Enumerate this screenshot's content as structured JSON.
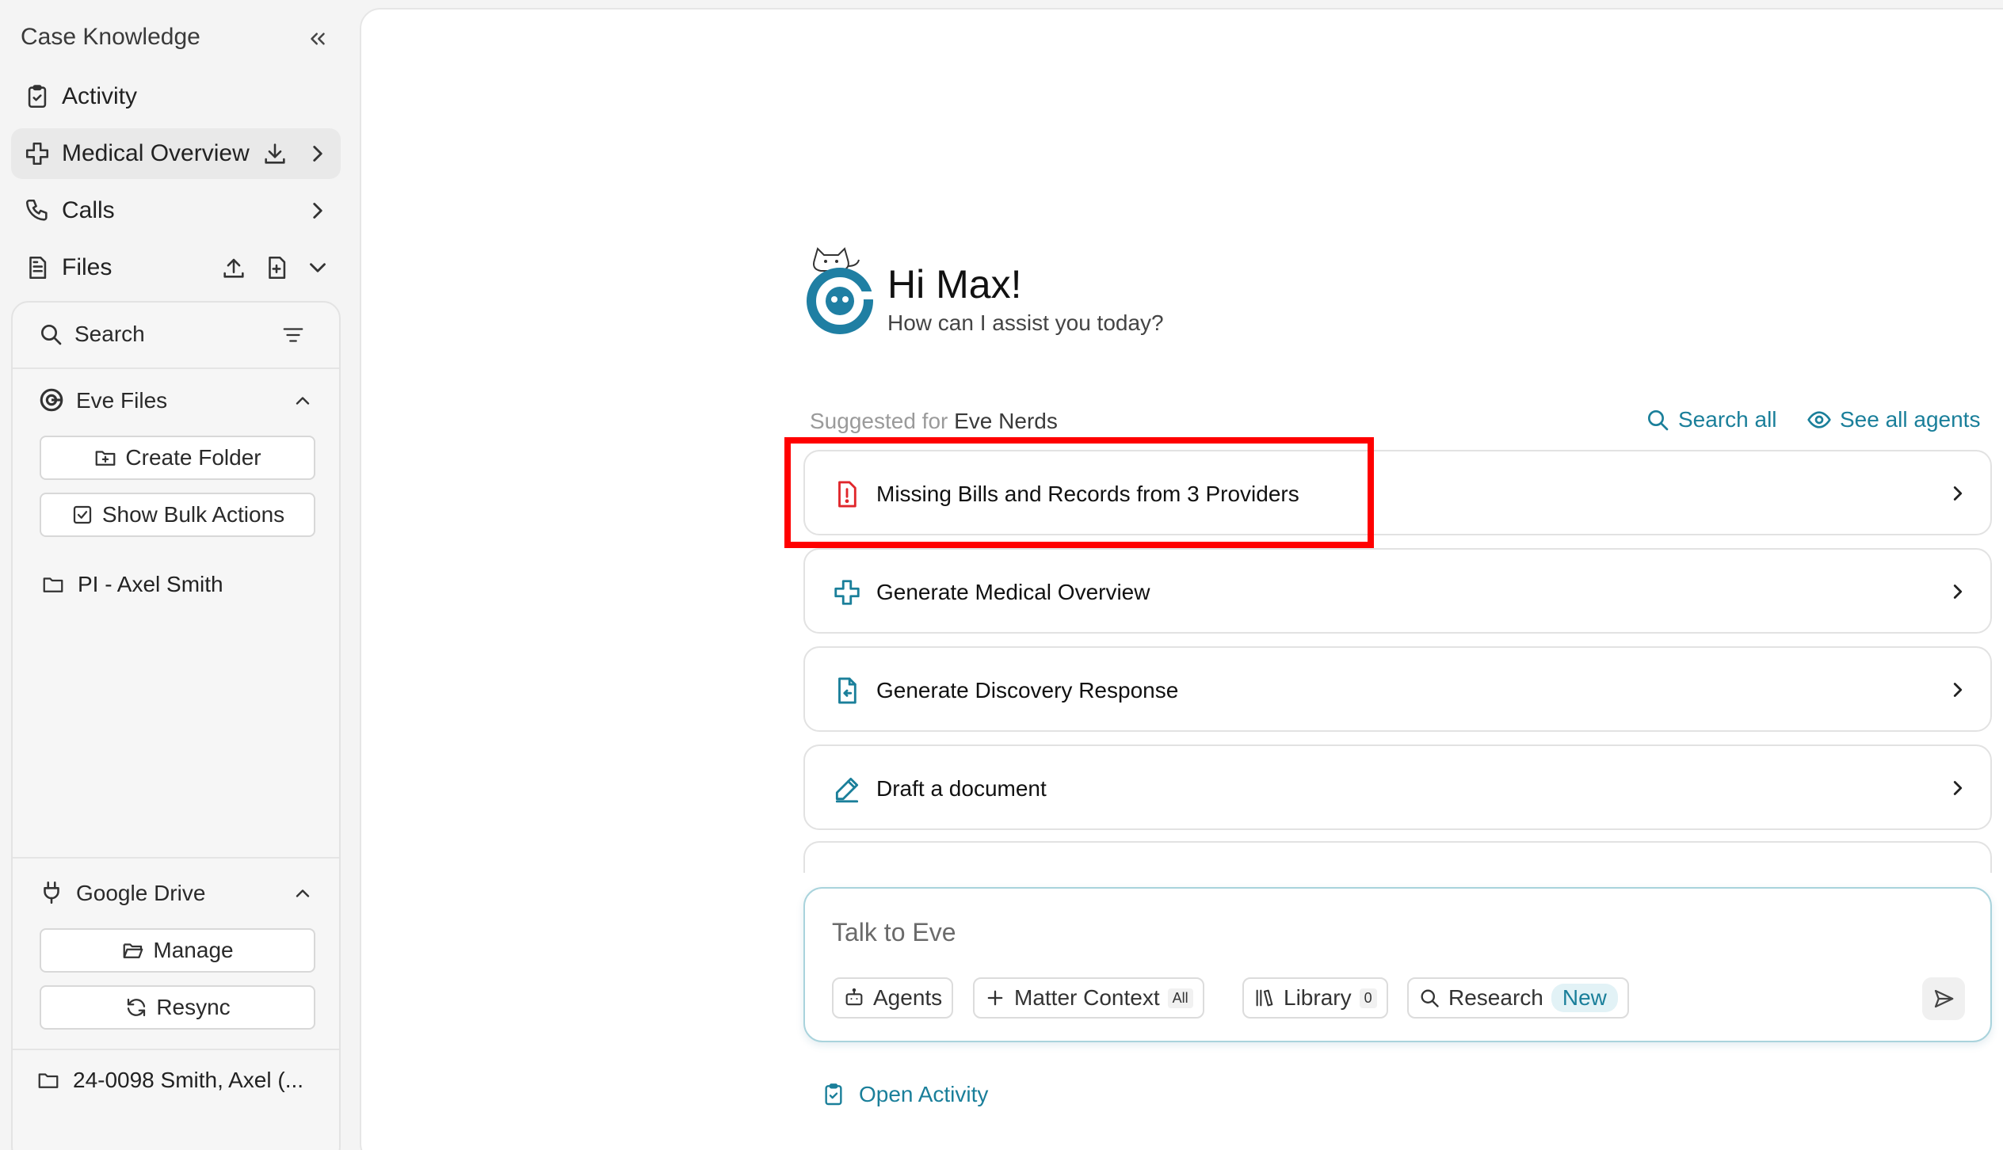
{
  "sidebar": {
    "title": "Case Knowledge",
    "nav": {
      "activity": "Activity",
      "medical_overview": "Medical Overview",
      "calls": "Calls",
      "files": "Files"
    },
    "files_panel": {
      "search_label": "Search",
      "eve_files": {
        "title": "Eve Files",
        "create_folder": "Create Folder",
        "show_bulk_actions": "Show Bulk Actions",
        "folders": [
          "PI - Axel Smith"
        ]
      },
      "google_drive": {
        "title": "Google Drive",
        "manage": "Manage",
        "resync": "Resync",
        "folders": [
          "24-0098 Smith, Axel (..."
        ]
      }
    }
  },
  "main": {
    "greeting": "Hi Max!",
    "subgreeting": "How can I assist you today?",
    "suggested_prefix": "Suggested for",
    "suggested_group": "Eve Nerds",
    "search_all": "Search all",
    "see_all_agents": "See all agents",
    "cards": [
      {
        "label": "Missing Bills and Records from 3 Providers",
        "icon": "alert-icon"
      },
      {
        "label": "Generate Medical Overview",
        "icon": "medical-cross-icon"
      },
      {
        "label": "Generate Discovery Response",
        "icon": "document-return-icon"
      },
      {
        "label": "Draft a document",
        "icon": "pencil-icon"
      }
    ],
    "composer": {
      "placeholder": "Talk to Eve",
      "agents": "Agents",
      "matter_context": "Matter Context",
      "matter_context_badge": "All",
      "library": "Library",
      "library_count": "0",
      "research": "Research",
      "research_badge": "New"
    },
    "open_activity": "Open Activity"
  },
  "colors": {
    "accent": "#1a7f9a",
    "alert": "#e0262b",
    "highlight": "#ff0000",
    "logo": "#1f7fa3"
  }
}
